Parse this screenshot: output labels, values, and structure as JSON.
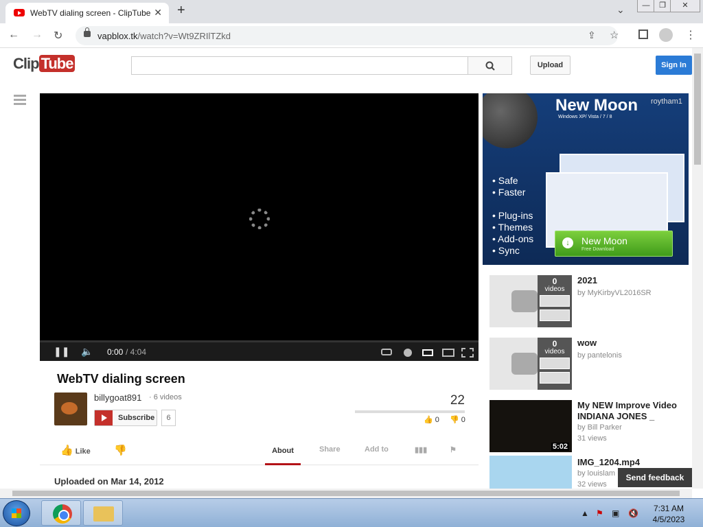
{
  "browser": {
    "tab_title": "WebTV dialing screen - ClipTube",
    "tab_close": "✕",
    "new_tab": "+",
    "url_domain": "vapblox.tk",
    "url_path": "/watch?v=Wt9ZRIlTZkd",
    "window_buttons": [
      "—",
      "❐",
      "✕"
    ],
    "tab_search": "⌄"
  },
  "site": {
    "logo_a": "Clip",
    "logo_b": "Tube",
    "search_placeholder": "",
    "upload_label": "Upload",
    "signin_label": "Sign In"
  },
  "player": {
    "time_current": "0:00",
    "time_total": "/ 4:04"
  },
  "video": {
    "title": "WebTV dialing screen",
    "owner": "billygoat891",
    "owner_videos": "· 6 videos",
    "subscribe_label": "Subscribe",
    "subscribers": "6",
    "views": "22",
    "likes": "0",
    "dislikes": "0",
    "like_fraction": 0,
    "like_label": "Like",
    "tabs": [
      "About",
      "Share",
      "Add to"
    ],
    "uploaded": "Uploaded on Mar 14, 2012"
  },
  "ad": {
    "headline": "New Moon",
    "subhead": "Windows XP/ Vista / 7 / 8",
    "user": "roytham1",
    "features": [
      "• Safe",
      "• Faster",
      "• Plug-ins",
      "• Themes",
      "• Add-ons",
      "• Sync"
    ],
    "download_title": "New Moon",
    "download_sub": "Free Download"
  },
  "related": [
    {
      "title": "2021",
      "by": "by MyKirbyVL2016SR",
      "views": "",
      "count": "0",
      "count_label": "videos",
      "duration": ""
    },
    {
      "title": "wow",
      "by": "by pantelonis",
      "views": "",
      "count": "0",
      "count_label": "videos",
      "duration": ""
    },
    {
      "title": "My NEW Improve Video INDIANA JONES _",
      "by": "by Bill Parker",
      "views": "31 views",
      "duration": "5:02"
    },
    {
      "title": "IMG_1204.mp4",
      "by": "by louislam",
      "views": "32 views",
      "duration": ""
    }
  ],
  "feedback_label": "Send feedback",
  "taskbar": {
    "time": "7:31 AM",
    "date": "4/5/2023"
  }
}
